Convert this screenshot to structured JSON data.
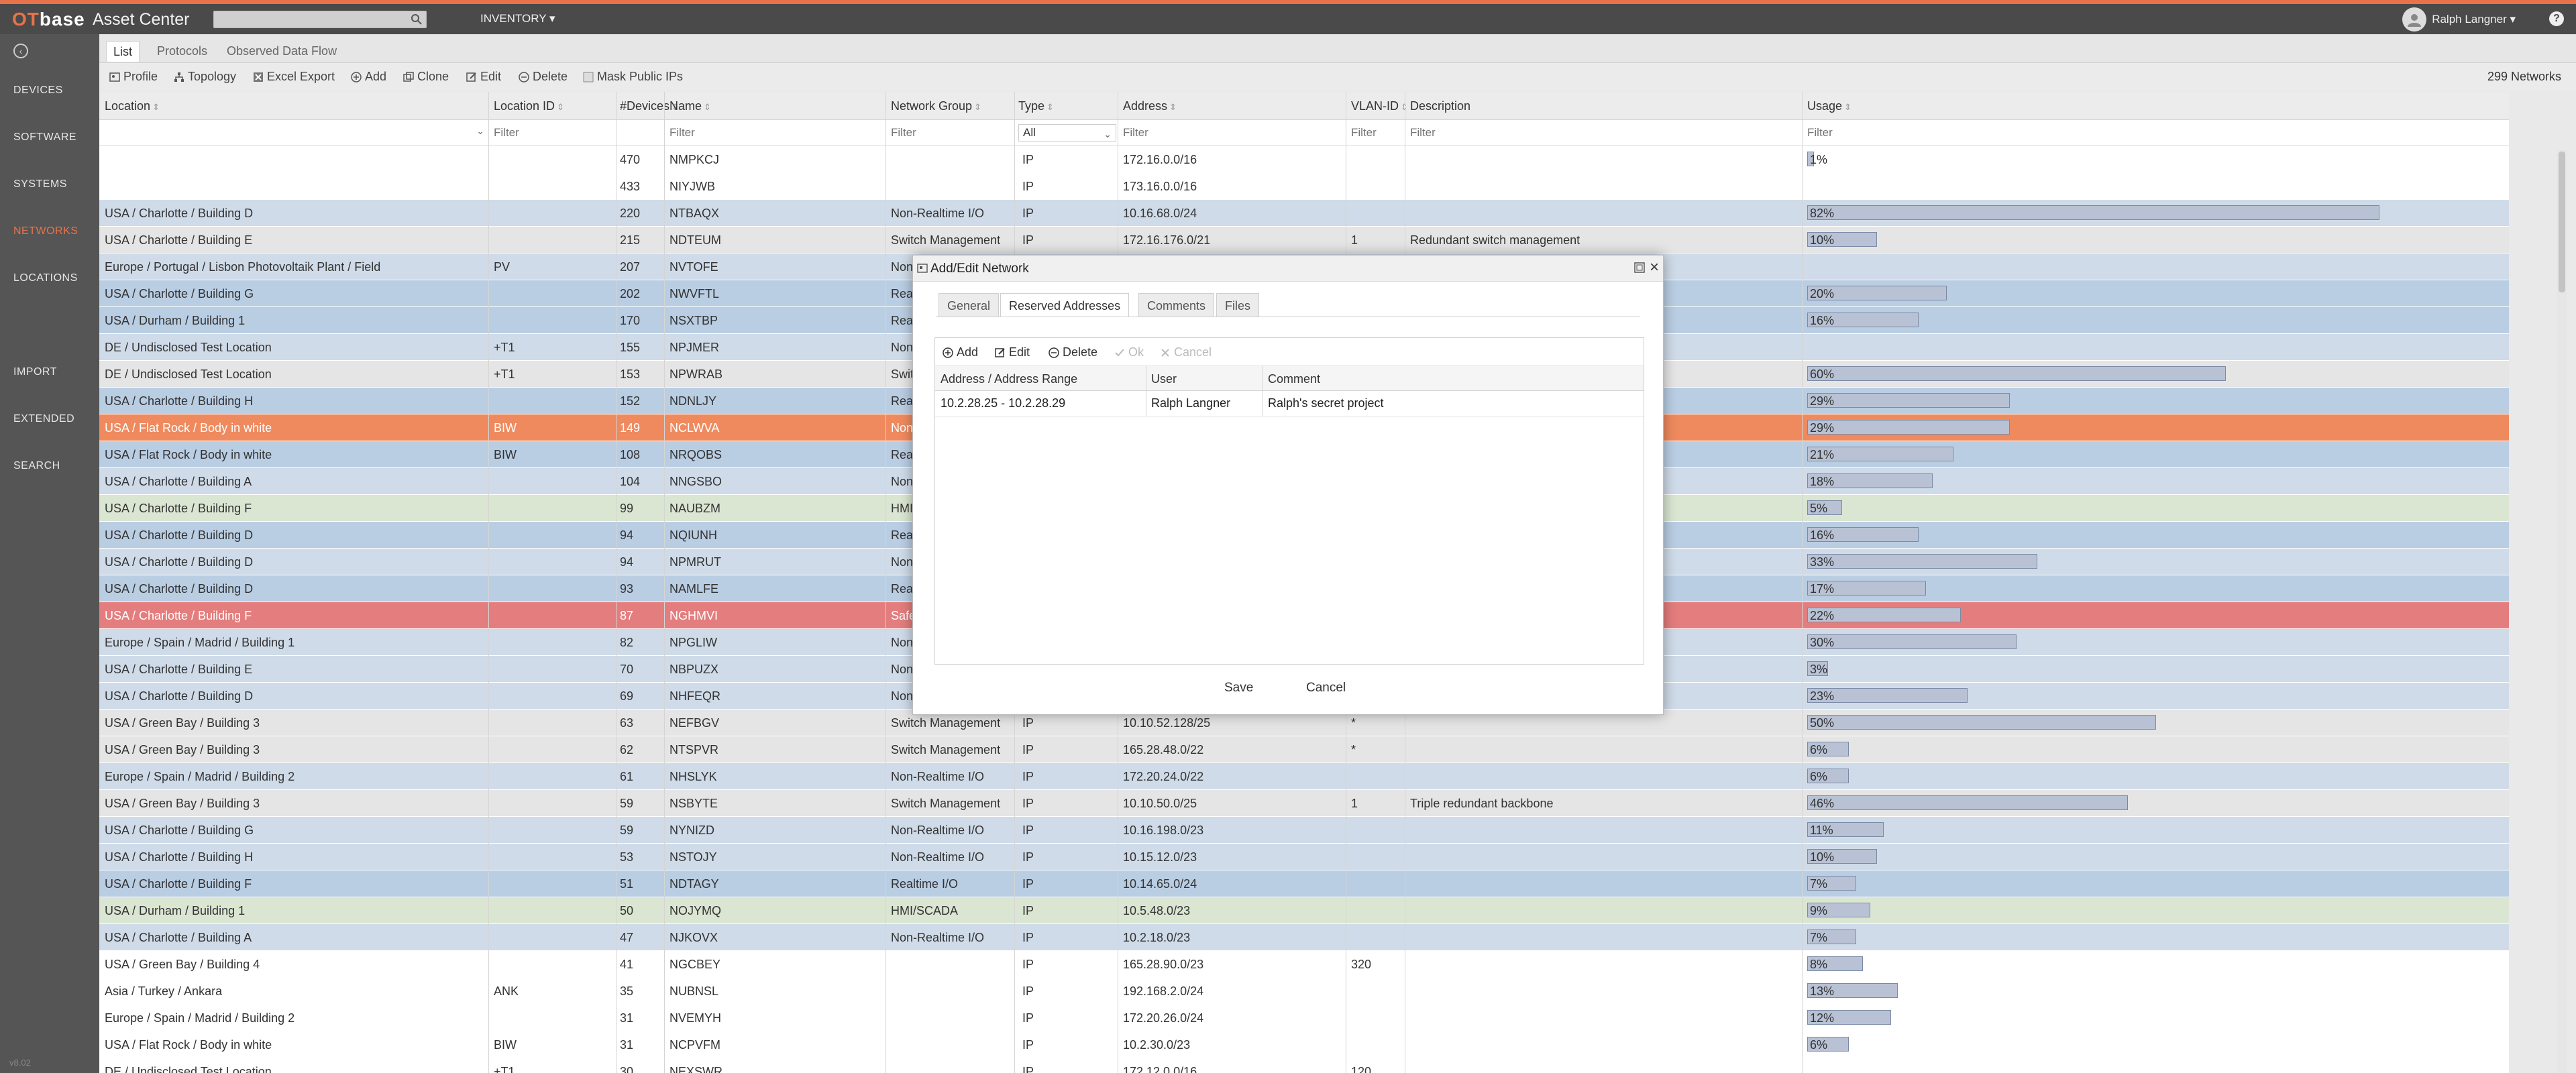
{
  "app": {
    "logo_ot": "OT",
    "logo_base": "base",
    "title": "Asset Center",
    "menu": "INVENTORY ▾",
    "user": "Ralph Langner ▾",
    "help": "?"
  },
  "search": {
    "placeholder": ""
  },
  "sidebar": {
    "items": [
      "DEVICES",
      "SOFTWARE",
      "SYSTEMS",
      "NETWORKS",
      "LOCATIONS",
      "IMPORT",
      "EXTENDED",
      "SEARCH"
    ],
    "active_index": 3,
    "version": "v8.02"
  },
  "tabs": [
    "List",
    "Protocols",
    "Observed Data Flow"
  ],
  "toolbar": {
    "items": [
      "Profile",
      "Topology",
      "Excel Export",
      "Add",
      "Clone",
      "Edit",
      "Delete",
      "Mask Public IPs"
    ],
    "count": "299 Networks"
  },
  "grid": {
    "headers": [
      "Location",
      "Location ID",
      "#Devices",
      "Name",
      "Network Group",
      "Type",
      "Address",
      "VLAN-ID",
      "Description",
      "Usage"
    ],
    "filter_placeholder": "Filter",
    "type_filter": "All",
    "rows": [
      {
        "loc": "",
        "lid": "",
        "dev": "470",
        "name": "NMPKCJ",
        "grp": "",
        "type": "IP",
        "addr": "172.16.0.0/16",
        "vlan": "",
        "desc": "",
        "usage": "1%",
        "u": 1,
        "bg": "#ffffff"
      },
      {
        "loc": "",
        "lid": "",
        "dev": "433",
        "name": "NIYJWB",
        "grp": "",
        "type": "IP",
        "addr": "173.16.0.0/16",
        "vlan": "",
        "desc": "",
        "usage": "",
        "u": 0,
        "bg": "#ffffff"
      },
      {
        "loc": "USA / Charlotte / Building D",
        "lid": "",
        "dev": "220",
        "name": "NTBAQX",
        "grp": "Non-Realtime I/O",
        "type": "IP",
        "addr": "10.16.68.0/24",
        "vlan": "",
        "desc": "",
        "usage": "82%",
        "u": 82,
        "bg": "#cfdbe8"
      },
      {
        "loc": "USA / Charlotte / Building E",
        "lid": "",
        "dev": "215",
        "name": "NDTEUM",
        "grp": "Switch Management",
        "type": "IP",
        "addr": "172.16.176.0/21",
        "vlan": "1",
        "desc": "Redundant switch management",
        "usage": "10%",
        "u": 10,
        "bg": "#e5e5e5"
      },
      {
        "loc": "Europe / Portugal / Lisbon Photovoltaik Plant / Field",
        "lid": "PV",
        "dev": "207",
        "name": "NVTOFE",
        "grp": "Non-Realtime I/O",
        "type": "",
        "addr": "",
        "vlan": "",
        "desc": "",
        "usage": "",
        "u": 0,
        "bg": "#cfdbe8"
      },
      {
        "loc": "USA / Charlotte / Building G",
        "lid": "",
        "dev": "202",
        "name": "NWVFTL",
        "grp": "Realtime I/O",
        "type": "",
        "addr": "",
        "vlan": "",
        "desc": "",
        "usage": "20%",
        "u": 20,
        "bg": "#b9cde3"
      },
      {
        "loc": "USA / Durham / Building 1",
        "lid": "",
        "dev": "170",
        "name": "NSXTBP",
        "grp": "Realtime I/O",
        "type": "",
        "addr": "",
        "vlan": "",
        "desc": "",
        "usage": "16%",
        "u": 16,
        "bg": "#b9cde3"
      },
      {
        "loc": "DE / Undisclosed Test Location",
        "lid": "+T1",
        "dev": "155",
        "name": "NPJMER",
        "grp": "Non-Realtime I/O",
        "type": "",
        "addr": "",
        "vlan": "",
        "desc": "",
        "usage": "",
        "u": 0,
        "bg": "#cfdbe8"
      },
      {
        "loc": "DE / Undisclosed Test Location",
        "lid": "+T1",
        "dev": "153",
        "name": "NPWRAB",
        "grp": "Switch Management",
        "type": "",
        "addr": "",
        "vlan": "",
        "desc": "",
        "usage": "60%",
        "u": 60,
        "bg": "#e5e5e5"
      },
      {
        "loc": "USA / Charlotte / Building H",
        "lid": "",
        "dev": "152",
        "name": "NDNLJY",
        "grp": "Realtime I/O",
        "type": "",
        "addr": "",
        "vlan": "",
        "desc": "",
        "usage": "29%",
        "u": 29,
        "bg": "#b9cde3"
      },
      {
        "loc": "USA / Flat Rock / Body in white",
        "lid": "BIW",
        "dev": "149",
        "name": "NCLWVA",
        "grp": "Non-Realtime I/O",
        "type": "",
        "addr": "",
        "vlan": "",
        "desc": "",
        "usage": "29%",
        "u": 29,
        "bg": "#ef8a5f",
        "hl": true
      },
      {
        "loc": "USA / Flat Rock / Body in white",
        "lid": "BIW",
        "dev": "108",
        "name": "NRQOBS",
        "grp": "Realtime I/O",
        "type": "",
        "addr": "",
        "vlan": "",
        "desc": "",
        "usage": "21%",
        "u": 21,
        "bg": "#b9cde3"
      },
      {
        "loc": "USA / Charlotte / Building A",
        "lid": "",
        "dev": "104",
        "name": "NNGSBO",
        "grp": "Non-Realtime I/O",
        "type": "",
        "addr": "",
        "vlan": "",
        "desc": "",
        "usage": "18%",
        "u": 18,
        "bg": "#cfdbe8"
      },
      {
        "loc": "USA / Charlotte / Building F",
        "lid": "",
        "dev": "99",
        "name": "NAUBZM",
        "grp": "HMI/SCADA",
        "type": "",
        "addr": "",
        "vlan": "",
        "desc": "",
        "usage": "5%",
        "u": 5,
        "bg": "#dbe6d2"
      },
      {
        "loc": "USA / Charlotte / Building D",
        "lid": "",
        "dev": "94",
        "name": "NQIUNH",
        "grp": "Realtime I/O",
        "type": "",
        "addr": "",
        "vlan": "",
        "desc": "",
        "usage": "16%",
        "u": 16,
        "bg": "#b9cde3"
      },
      {
        "loc": "USA / Charlotte / Building D",
        "lid": "",
        "dev": "94",
        "name": "NPMRUT",
        "grp": "Non-Realtime I/O",
        "type": "",
        "addr": "",
        "vlan": "",
        "desc": "",
        "usage": "33%",
        "u": 33,
        "bg": "#cfdbe8"
      },
      {
        "loc": "USA / Charlotte / Building D",
        "lid": "",
        "dev": "93",
        "name": "NAMLFE",
        "grp": "Realtime I/O",
        "type": "",
        "addr": "",
        "vlan": "",
        "desc": "",
        "usage": "17%",
        "u": 17,
        "bg": "#b9cde3"
      },
      {
        "loc": "USA / Charlotte / Building F",
        "lid": "",
        "dev": "87",
        "name": "NGHMVI",
        "grp": "Safety",
        "type": "",
        "addr": "",
        "vlan": "",
        "desc": "",
        "usage": "22%",
        "u": 22,
        "bg": "#e47d7d",
        "hl": true
      },
      {
        "loc": "Europe / Spain / Madrid / Building 1",
        "lid": "",
        "dev": "82",
        "name": "NPGLIW",
        "grp": "Non-Realtime I/O",
        "type": "",
        "addr": "",
        "vlan": "",
        "desc": "",
        "usage": "30%",
        "u": 30,
        "bg": "#cfdbe8"
      },
      {
        "loc": "USA / Charlotte / Building E",
        "lid": "",
        "dev": "70",
        "name": "NBPUZX",
        "grp": "Non-Realtime I/O",
        "type": "",
        "addr": "",
        "vlan": "",
        "desc": "",
        "usage": "3%",
        "u": 3,
        "bg": "#cfdbe8"
      },
      {
        "loc": "USA / Charlotte / Building D",
        "lid": "",
        "dev": "69",
        "name": "NHFEQR",
        "grp": "Non-Realtime I/O",
        "type": "",
        "addr": "",
        "vlan": "",
        "desc": "",
        "usage": "23%",
        "u": 23,
        "bg": "#cfdbe8"
      },
      {
        "loc": "USA / Green Bay / Building 3",
        "lid": "",
        "dev": "63",
        "name": "NEFBGV",
        "grp": "Switch Management",
        "type": "IP",
        "addr": "10.10.52.128/25",
        "vlan": "*",
        "desc": "",
        "usage": "50%",
        "u": 50,
        "bg": "#e5e5e5"
      },
      {
        "loc": "USA / Green Bay / Building 3",
        "lid": "",
        "dev": "62",
        "name": "NTSPVR",
        "grp": "Switch Management",
        "type": "IP",
        "addr": "165.28.48.0/22",
        "vlan": "*",
        "desc": "",
        "usage": "6%",
        "u": 6,
        "bg": "#e5e5e5"
      },
      {
        "loc": "Europe / Spain / Madrid / Building 2",
        "lid": "",
        "dev": "61",
        "name": "NHSLYK",
        "grp": "Non-Realtime I/O",
        "type": "IP",
        "addr": "172.20.24.0/22",
        "vlan": "",
        "desc": "",
        "usage": "6%",
        "u": 6,
        "bg": "#cfdbe8"
      },
      {
        "loc": "USA / Green Bay / Building 3",
        "lid": "",
        "dev": "59",
        "name": "NSBYTE",
        "grp": "Switch Management",
        "type": "IP",
        "addr": "10.10.50.0/25",
        "vlan": "1",
        "desc": "Triple redundant backbone",
        "usage": "46%",
        "u": 46,
        "bg": "#e5e5e5"
      },
      {
        "loc": "USA / Charlotte / Building G",
        "lid": "",
        "dev": "59",
        "name": "NYNIZD",
        "grp": "Non-Realtime I/O",
        "type": "IP",
        "addr": "10.16.198.0/23",
        "vlan": "",
        "desc": "",
        "usage": "11%",
        "u": 11,
        "bg": "#cfdbe8"
      },
      {
        "loc": "USA / Charlotte / Building H",
        "lid": "",
        "dev": "53",
        "name": "NSTOJY",
        "grp": "Non-Realtime I/O",
        "type": "IP",
        "addr": "10.15.12.0/23",
        "vlan": "",
        "desc": "",
        "usage": "10%",
        "u": 10,
        "bg": "#cfdbe8"
      },
      {
        "loc": "USA / Charlotte / Building F",
        "lid": "",
        "dev": "51",
        "name": "NDTAGY",
        "grp": "Realtime I/O",
        "type": "IP",
        "addr": "10.14.65.0/24",
        "vlan": "",
        "desc": "",
        "usage": "7%",
        "u": 7,
        "bg": "#b9cde3"
      },
      {
        "loc": "USA / Durham / Building 1",
        "lid": "",
        "dev": "50",
        "name": "NOJYMQ",
        "grp": "HMI/SCADA",
        "type": "IP",
        "addr": "10.5.48.0/23",
        "vlan": "",
        "desc": "",
        "usage": "9%",
        "u": 9,
        "bg": "#dbe6d2"
      },
      {
        "loc": "USA / Charlotte / Building A",
        "lid": "",
        "dev": "47",
        "name": "NJKOVX",
        "grp": "Non-Realtime I/O",
        "type": "IP",
        "addr": "10.2.18.0/23",
        "vlan": "",
        "desc": "",
        "usage": "7%",
        "u": 7,
        "bg": "#cfdbe8"
      },
      {
        "loc": "USA / Green Bay / Building 4",
        "lid": "",
        "dev": "41",
        "name": "NGCBEY",
        "grp": "",
        "type": "IP",
        "addr": "165.28.90.0/23",
        "vlan": "320",
        "desc": "",
        "usage": "8%",
        "u": 8,
        "bg": "#ffffff"
      },
      {
        "loc": "Asia / Turkey / Ankara",
        "lid": "ANK",
        "dev": "35",
        "name": "NUBNSL",
        "grp": "",
        "type": "IP",
        "addr": "192.168.2.0/24",
        "vlan": "",
        "desc": "",
        "usage": "13%",
        "u": 13,
        "bg": "#ffffff"
      },
      {
        "loc": "Europe / Spain / Madrid / Building 2",
        "lid": "",
        "dev": "31",
        "name": "NVEMYH",
        "grp": "",
        "type": "IP",
        "addr": "172.20.26.0/24",
        "vlan": "",
        "desc": "",
        "usage": "12%",
        "u": 12,
        "bg": "#ffffff"
      },
      {
        "loc": "USA / Flat Rock / Body in white",
        "lid": "BIW",
        "dev": "31",
        "name": "NCPVFM",
        "grp": "",
        "type": "IP",
        "addr": "10.2.30.0/23",
        "vlan": "",
        "desc": "",
        "usage": "6%",
        "u": 6,
        "bg": "#ffffff"
      },
      {
        "loc": "DE / Undisclosed Test Location",
        "lid": "+T1",
        "dev": "30",
        "name": "NEXSWR",
        "grp": "",
        "type": "IP",
        "addr": "172.12.0.0/16",
        "vlan": "120",
        "desc": "",
        "usage": "",
        "u": 0,
        "bg": "#ffffff"
      }
    ]
  },
  "modal": {
    "title": "Add/Edit Network",
    "tabs": [
      "General",
      "Reserved Addresses",
      "Comments",
      "Files"
    ],
    "active_tab": 1,
    "panel_tools": [
      "Add",
      "Edit",
      "Delete",
      "Ok",
      "Cancel"
    ],
    "columns": [
      "Address / Address Range",
      "User",
      "Comment"
    ],
    "rows": [
      {
        "range": "10.2.28.25 - 10.2.28.29",
        "user": "Ralph Langner",
        "comment": "Ralph's secret project"
      }
    ],
    "save": "Save",
    "cancel": "Cancel"
  }
}
